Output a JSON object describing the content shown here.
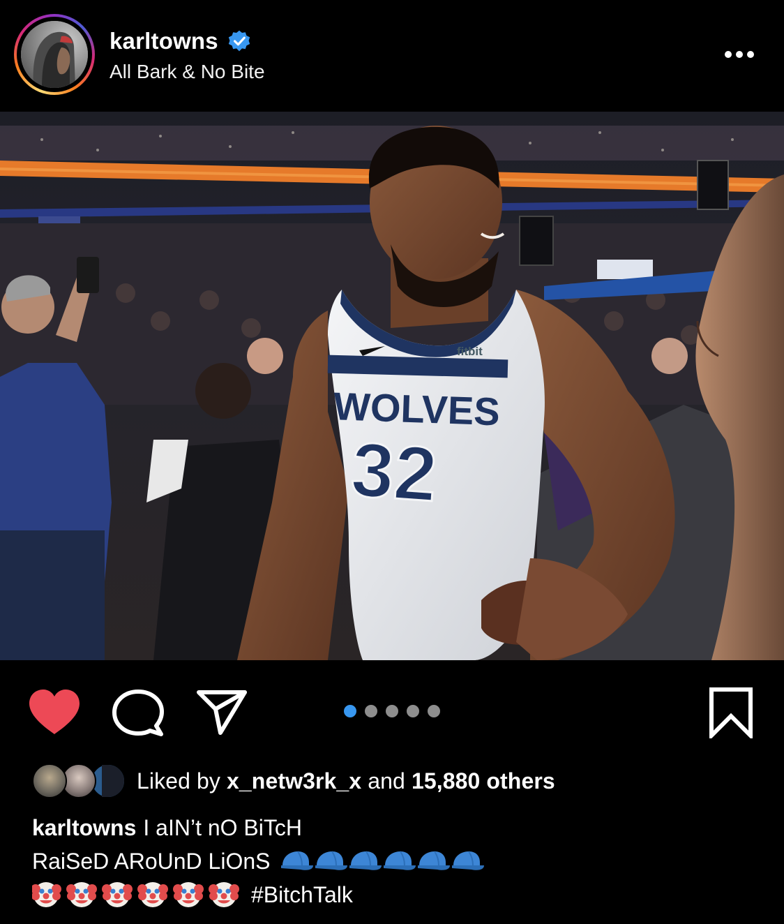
{
  "header": {
    "username": "karltowns",
    "subtitle": "All Bark & No Bite"
  },
  "photo": {
    "jersey_team": "WOLVES",
    "jersey_number": "32",
    "sponsor": "fitbit"
  },
  "actions": {
    "liked": true,
    "carousel_total": 5,
    "carousel_active": 1
  },
  "likes": {
    "prefix": "Liked by",
    "first_liker": "x_netw3rk_x",
    "and": "and",
    "others": "15,880 others"
  },
  "caption": {
    "username": "karltowns",
    "line1": "I aIN’t nO BiTcH",
    "line2": "RaiSeD ARoUnD LiOnS",
    "hashtag": "#BitchTalk"
  },
  "colors": {
    "like_red": "#ed4956",
    "carousel_active": "#3897f0",
    "verified_blue": "#3897f0"
  }
}
